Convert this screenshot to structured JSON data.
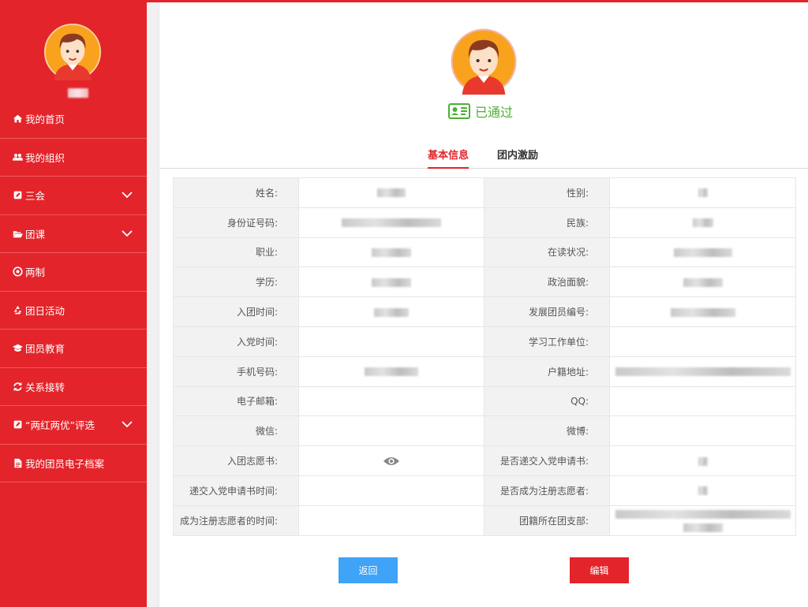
{
  "sidebar": {
    "items": [
      {
        "label": "我的首页",
        "icon": "home-icon",
        "expandable": false
      },
      {
        "label": "我的组织",
        "icon": "users-icon",
        "expandable": false
      },
      {
        "label": "三会",
        "icon": "edit-icon",
        "expandable": true
      },
      {
        "label": "团课",
        "icon": "folder-open-icon",
        "expandable": true
      },
      {
        "label": "两制",
        "icon": "target-icon",
        "expandable": false
      },
      {
        "label": "团日活动",
        "icon": "recycle-icon",
        "expandable": false
      },
      {
        "label": "团员教育",
        "icon": "graduation-cap-icon",
        "expandable": false
      },
      {
        "label": "关系接转",
        "icon": "refresh-icon",
        "expandable": false
      },
      {
        "label": "“两红两优”评选",
        "icon": "edit-icon",
        "expandable": true
      },
      {
        "label": "我的团员电子档案",
        "icon": "file-icon",
        "expandable": false
      }
    ]
  },
  "profile": {
    "status": "已通过",
    "status_color": "#4caf35"
  },
  "tabs": {
    "basic": "基本信息",
    "reward": "团内激励"
  },
  "fields": {
    "name": "姓名:",
    "gender": "性别:",
    "id_number": "身份证号码:",
    "ethnicity": "民族:",
    "occupation": "职业:",
    "study_status": "在读状况:",
    "education": "学历:",
    "political_status": "政治面貌:",
    "join_league_time": "入团时间:",
    "member_number": "发展团员编号:",
    "join_party_time": "入党时间:",
    "work_unit": "学习工作单位:",
    "phone": "手机号码:",
    "household_address": "户籍地址:",
    "email": "电子邮箱:",
    "qq": "QQ:",
    "wechat": "微信:",
    "weibo": "微博:",
    "application_letter": "入团志愿书:",
    "submitted_party_application": "是否递交入党申请书:",
    "party_application_time": "递交入党申请书时间:",
    "registered_volunteer": "是否成为注册志愿者:",
    "volunteer_time": "成为注册志愿者的时间:",
    "branch": "团籍所在团支部:"
  },
  "buttons": {
    "back": "返回",
    "edit": "编辑"
  },
  "colors": {
    "brand_red": "#e3242b",
    "button_blue": "#3fa3f7"
  }
}
